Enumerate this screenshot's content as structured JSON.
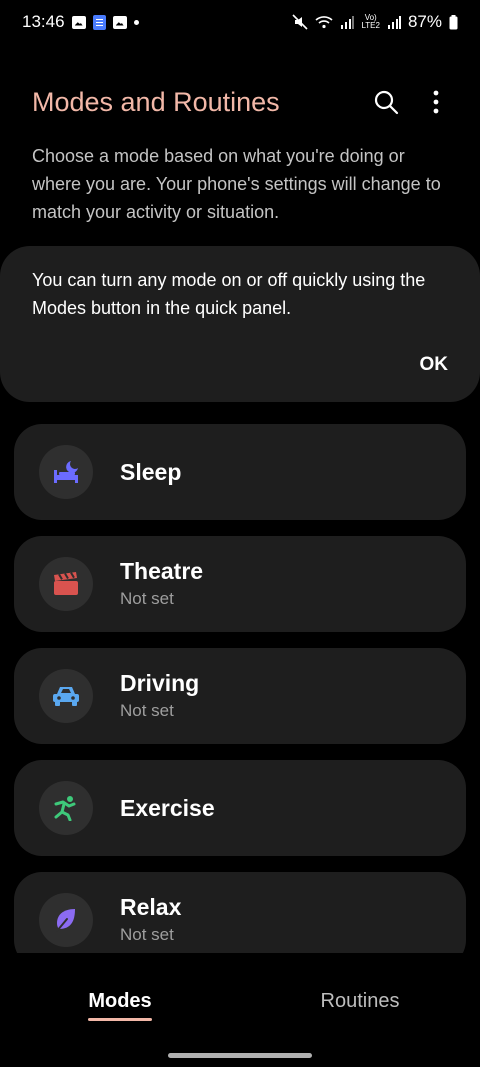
{
  "status_bar": {
    "time": "13:46",
    "network_label": "Vo)\nLTE2",
    "battery": "87%"
  },
  "header": {
    "title": "Modes and Routines",
    "search_icon": "search-icon",
    "more_icon": "more-vertical-icon"
  },
  "description": "Choose a mode based on what you're doing or where you are. Your phone's settings will change to match your activity or situation.",
  "tip_card": {
    "text": "You can turn any mode on or off quickly using the Modes button in the quick panel.",
    "ok_label": "OK"
  },
  "modes": [
    {
      "name": "Sleep",
      "subtitle": "",
      "icon": "bed-moon-icon",
      "color": "#6b6bff"
    },
    {
      "name": "Theatre",
      "subtitle": "Not set",
      "icon": "clapperboard-icon",
      "color": "#d9534f"
    },
    {
      "name": "Driving",
      "subtitle": "Not set",
      "icon": "car-icon",
      "color": "#5aa8f0"
    },
    {
      "name": "Exercise",
      "subtitle": "",
      "icon": "running-person-icon",
      "color": "#3ec97a"
    },
    {
      "name": "Relax",
      "subtitle": "Not set",
      "icon": "leaf-icon",
      "color": "#8b6bf2"
    }
  ],
  "bottom_nav": {
    "tabs": [
      {
        "label": "Modes",
        "active": true
      },
      {
        "label": "Routines",
        "active": false
      }
    ],
    "accent": "#f2b8a8"
  }
}
